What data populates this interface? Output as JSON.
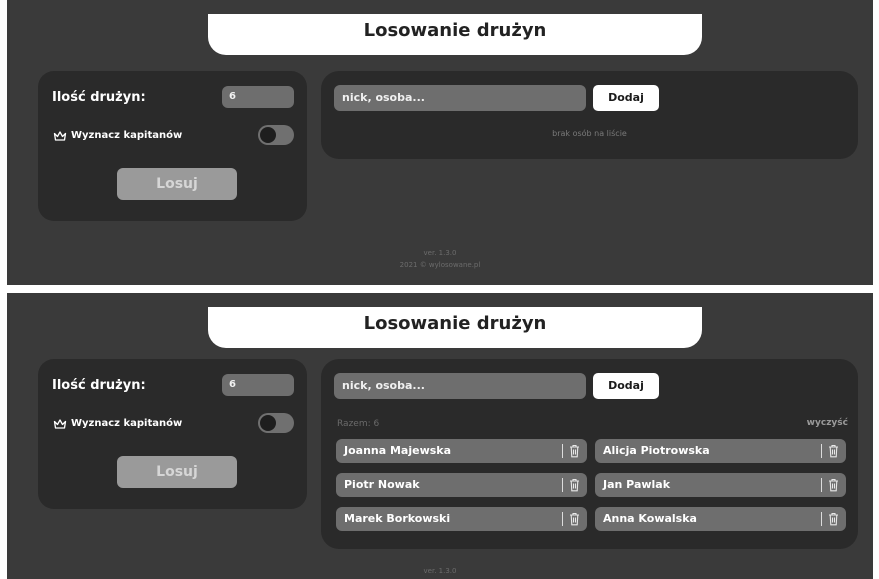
{
  "screens": [
    {
      "title": "Losowanie drużyn",
      "teams_label": "Ilość drużyn:",
      "teams_value": "6",
      "captains_label": "Wyznacz kapitanów",
      "captains_enabled": false,
      "draw_button": "Losuj",
      "input_placeholder": "nick, osoba...",
      "add_button": "Dodaj",
      "empty_message": "brak osób na liście",
      "footer_version": "ver. 1.3.0",
      "footer_copyright": "2021 © wylosowane.pl"
    },
    {
      "title": "Losowanie drużyn",
      "teams_label": "Ilość drużyn:",
      "teams_value": "6",
      "captains_label": "Wyznacz kapitanów",
      "captains_enabled": false,
      "draw_button": "Losuj",
      "input_placeholder": "nick, osoba...",
      "add_button": "Dodaj",
      "total_label": "Razem: 6",
      "clear_label": "wyczyść",
      "people": [
        "Joanna Majewska",
        "Alicja Piotrowska",
        "Piotr Nowak",
        "Jan Pawlak",
        "Marek Borkowski",
        "Anna Kowalska"
      ],
      "footer_version": "ver. 1.3.0"
    }
  ],
  "icons": {
    "crown": "crown-icon",
    "trash": "trash-icon",
    "toggle": "toggle-switch"
  },
  "colors": {
    "page_bg": "#3a3a3a",
    "card_bg": "#2a2a2a",
    "field_bg": "#6e6e6e",
    "draw_button_bg": "#9a9a9a",
    "title_bg": "#ffffff"
  }
}
